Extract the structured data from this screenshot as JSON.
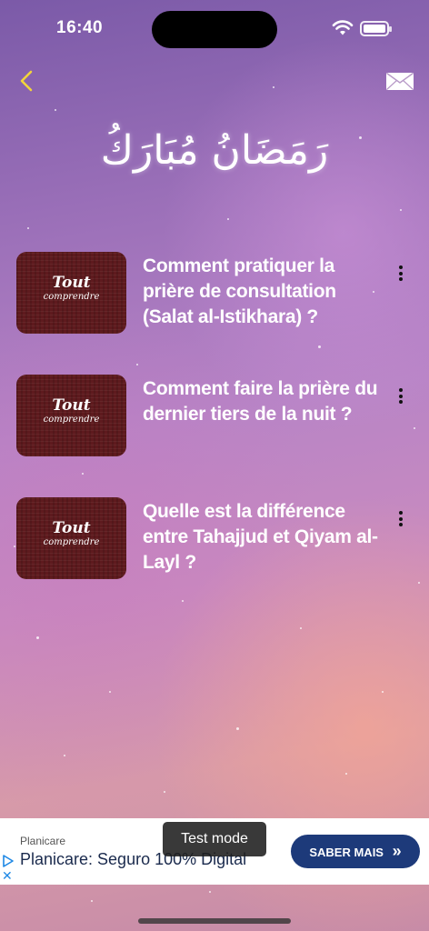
{
  "status_bar": {
    "time": "16:40"
  },
  "header": {
    "back_icon": "chevron-left-icon",
    "mail_icon": "envelope-icon",
    "calligraphy": "رَمَضَانُ مُبَارَكُ",
    "accent_color": "#f2d43a"
  },
  "videos": [
    {
      "thumbnail_title": "Tout",
      "thumbnail_subtitle": "comprendre",
      "title": "Comment pratiquer la prière de consultation (Salat al-Istikhara) ?"
    },
    {
      "thumbnail_title": "Tout",
      "thumbnail_subtitle": "comprendre",
      "title": "Comment faire la prière du dernier tiers de la nuit ?"
    },
    {
      "thumbnail_title": "Tout",
      "thumbnail_subtitle": "comprendre",
      "title": "Quelle est la différence entre Tahajjud et Qiyam al-Layl ?"
    }
  ],
  "ad": {
    "advertiser": "Planicare",
    "headline": "Planicare: Seguro 100% Digital",
    "cta": "SABER MAIS",
    "cta_icon": "double-chevron-right-icon",
    "test_mode_label": "Test mode"
  }
}
